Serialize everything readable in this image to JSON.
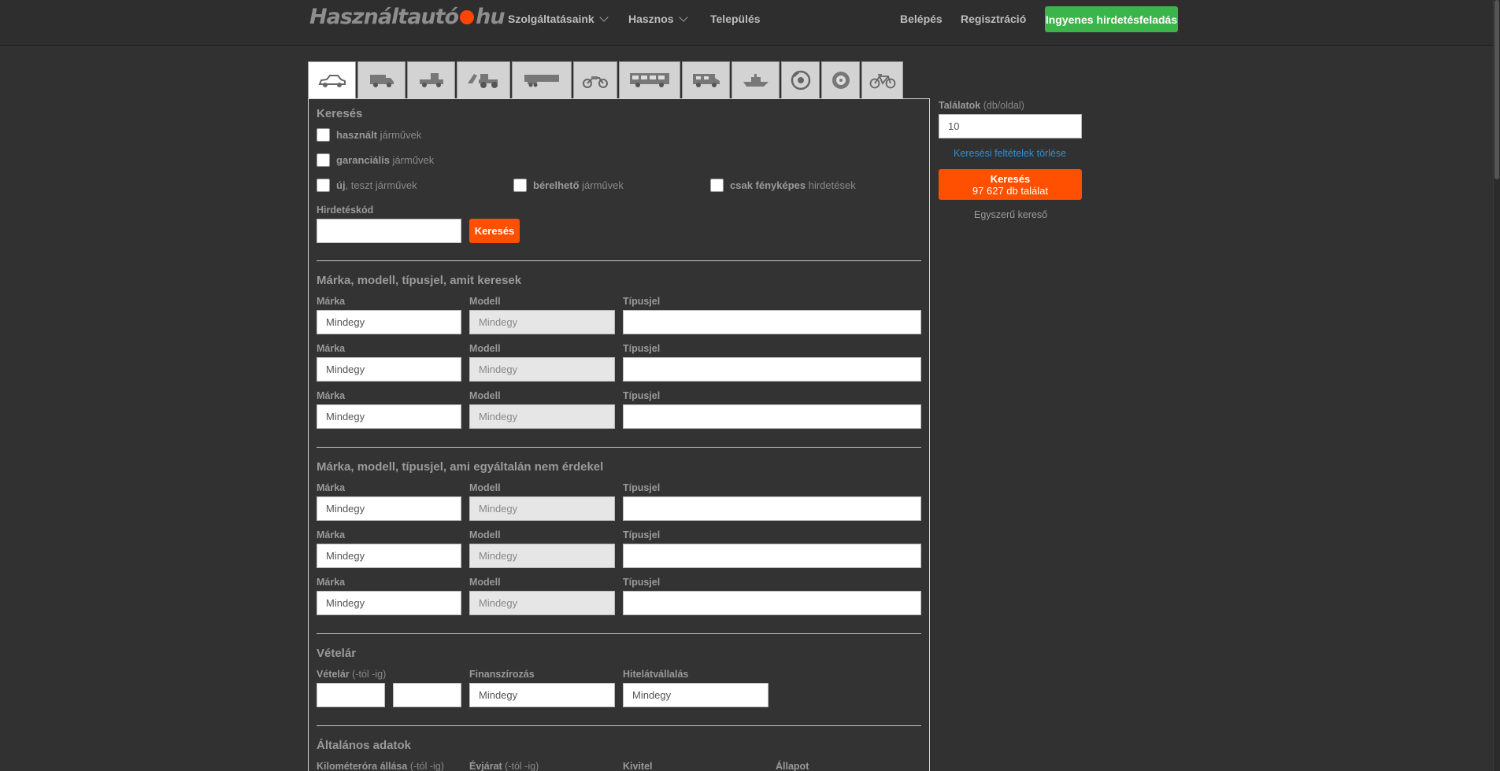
{
  "header": {
    "logo_left": "Használtautó",
    "logo_right": "hu",
    "nav": [
      {
        "label": "Szolgáltatásaink"
      },
      {
        "label": "Hasznos"
      },
      {
        "label": "Település"
      }
    ],
    "login": "Belépés",
    "register": "Regisztráció",
    "cta": "Ingyenes hirdetésfeladás"
  },
  "tabs": [
    {
      "icon": "car-icon"
    },
    {
      "icon": "van-icon"
    },
    {
      "icon": "truck-icon"
    },
    {
      "icon": "tractor-icon"
    },
    {
      "icon": "trailer-icon"
    },
    {
      "icon": "motorcycle-icon"
    },
    {
      "icon": "bus-icon"
    },
    {
      "icon": "camper-icon"
    },
    {
      "icon": "boat-icon"
    },
    {
      "icon": "brake-disc-icon"
    },
    {
      "icon": "tire-icon"
    },
    {
      "icon": "bicycle-icon"
    }
  ],
  "search": {
    "title": "Keresés",
    "cb_used_bold": "használt",
    "cb_used_rest": " járművek",
    "cb_warranty_bold": "garanciális",
    "cb_warranty_rest": " járművek",
    "cb_new_bold": "új",
    "cb_new_rest": ", teszt járművek",
    "cb_rent_bold": "bérelhető",
    "cb_rent_rest": " járművek",
    "cb_photo_bold": "csak fényképes",
    "cb_photo_rest": " hirdetések",
    "adcode_label": "Hirdetéskód",
    "adcode_value": "",
    "adcode_button": "Keresés"
  },
  "include": {
    "title": "Márka, modell, típusjel, amit keresek",
    "brand_label": "Márka",
    "model_label": "Modell",
    "type_label": "Típusjel",
    "any": "Mindegy"
  },
  "exclude": {
    "title": "Márka, modell, típusjel, ami egyáltalán nem érdekel",
    "brand_label": "Márka",
    "model_label": "Modell",
    "type_label": "Típusjel",
    "any": "Mindegy"
  },
  "price": {
    "title": "Vételár",
    "price_label": "Vételár",
    "price_sub": " (-tól -ig)",
    "financing_label": "Finanszírozás",
    "financing_value": "Mindegy",
    "credit_label": "Hitelátvállalás",
    "credit_value": "Mindegy"
  },
  "general": {
    "title": "Általános adatok",
    "km_label": "Kilométeróra állása",
    "km_sub": " (-tól -ig)",
    "year_label": "Évjárat",
    "year_sub": " (-tól -ig)",
    "body_label": "Kivitel",
    "condition_label": "Állapot"
  },
  "sidebar": {
    "results_label": "Találatok",
    "results_sub": " (db/oldal)",
    "results_value": "10",
    "clear_link": "Keresési feltételek törlése",
    "search_button": "Keresés",
    "search_count": "97 627 db találat",
    "simple_link": "Egyszerű kereső"
  }
}
